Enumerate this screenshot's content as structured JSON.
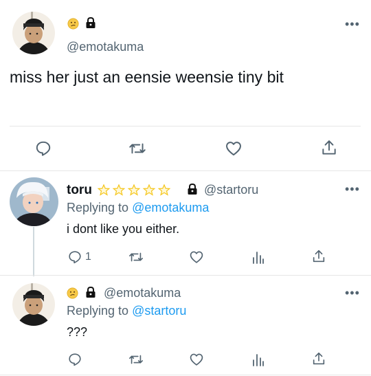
{
  "main_tweet": {
    "handle": "@emotakuma",
    "text": "miss her just an eensie weensie tiny bit",
    "more_label": "•••"
  },
  "reply1": {
    "name": "toru",
    "star_count": 5,
    "handle": "@startoru",
    "replying_prefix": "Replying to",
    "replying_to": "@emotakuma",
    "text": "i dont like you either.",
    "reply_count": "1",
    "more_label": "•••"
  },
  "reply2": {
    "handle": "@emotakuma",
    "replying_prefix": "Replying to",
    "replying_to": "@startoru",
    "text": "???",
    "more_label": "•••"
  },
  "colors": {
    "accent": "#1d9bf0",
    "secondary_text": "#536471",
    "star": "#f5c518"
  }
}
